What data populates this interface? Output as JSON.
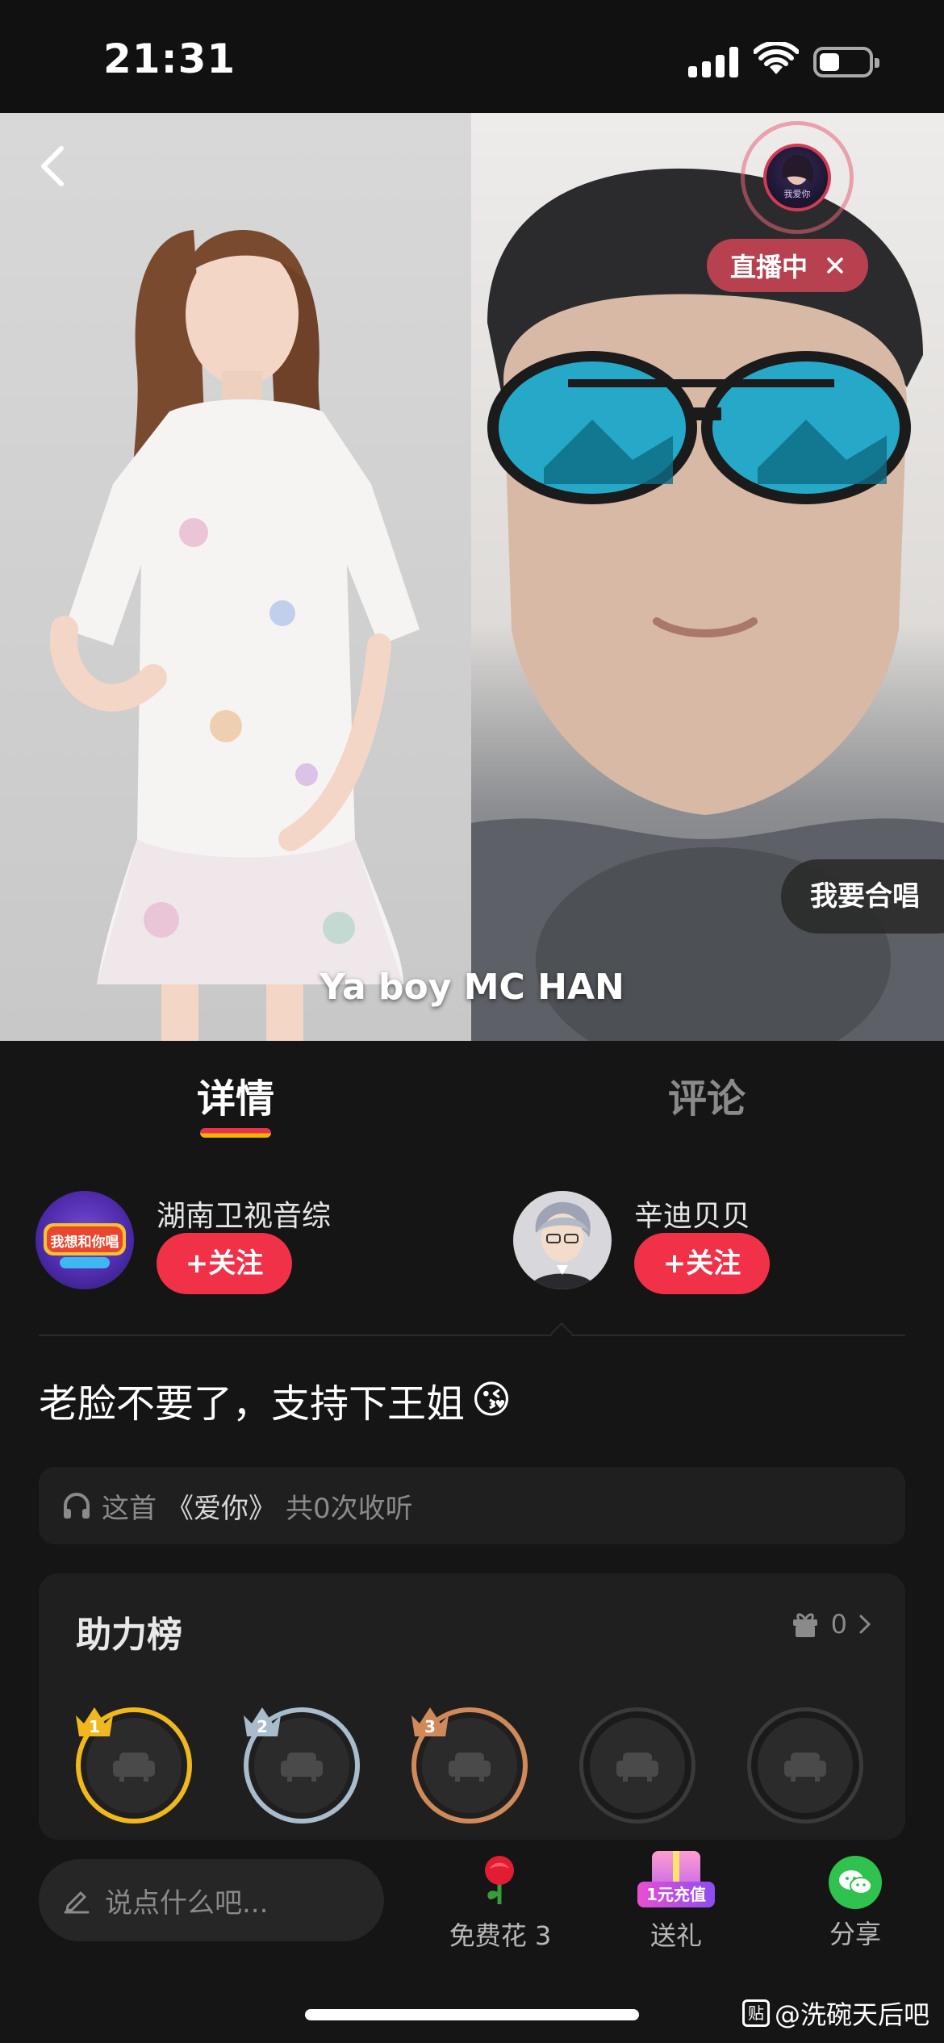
{
  "status_bar": {
    "time": "21:31"
  },
  "video": {
    "live_badge": "直播中",
    "live_avatar_text": "我爱你",
    "join_button": "我要合唱",
    "caption": "Ya boy MC HAN"
  },
  "tabs": [
    {
      "label": "详情",
      "active": true
    },
    {
      "label": "评论",
      "active": false
    }
  ],
  "users": [
    {
      "name": "湖南卫视音综",
      "follow_label": "+关注",
      "avatar_text": "我想和你唱"
    },
    {
      "name": "辛迪贝贝",
      "follow_label": "+关注"
    }
  ],
  "post": {
    "text": "老脸不要了，支持下王姐",
    "emoji": "😘"
  },
  "listen": {
    "prefix": "这首",
    "song": "《爱你》",
    "suffix": "共0次收听"
  },
  "ranking": {
    "title": "助力榜",
    "gift_count": "0",
    "seats": [
      {
        "rank": "1",
        "color": "#f0b81e"
      },
      {
        "rank": "2",
        "color": "#a9bccb"
      },
      {
        "rank": "3",
        "color": "#d08a5a"
      },
      {
        "rank": "",
        "color": "#3a3a3a"
      },
      {
        "rank": "",
        "color": "#3a3a3a"
      }
    ]
  },
  "bottom_bar": {
    "comment_placeholder": "说点什么吧...",
    "free_flower_label": "免费花 3",
    "gift_badge": "1元充值",
    "gift_label": "送礼",
    "share_label": "分享"
  },
  "watermark": {
    "logo": "贴",
    "text": "@洗碗天后吧"
  },
  "colors": {
    "background": "#151515",
    "accent_red": "#f03147",
    "rank_gold": "#f0b81e",
    "rank_silver": "#a9bccb",
    "rank_bronze": "#d08a5a"
  }
}
